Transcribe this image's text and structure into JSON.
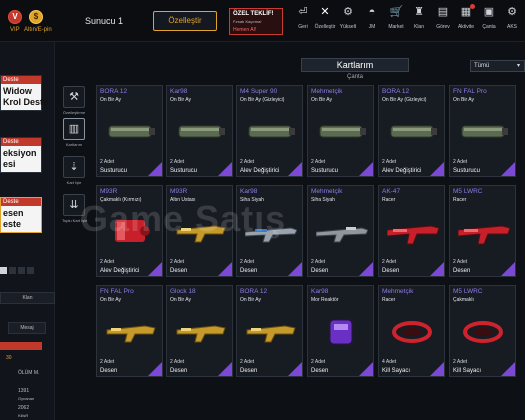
{
  "header": {
    "vip_label": "VIP",
    "currency_label": "Altın/E-pin",
    "server": "Sunucu 1",
    "customize": "Özelleştir",
    "offer": {
      "title": "ÖZEL TEKLİF!",
      "subtitle": "Fırsatı Kaçırma!",
      "timer": "Hemen Al!"
    }
  },
  "nav": [
    {
      "label": "Geri",
      "icon": "back-icon"
    },
    {
      "label": "Özelleştir",
      "icon": "tools-icon"
    },
    {
      "label": "Yükselt",
      "icon": "upgrade-icon"
    },
    {
      "label": "JM",
      "icon": "helmet-icon"
    },
    {
      "label": "Market",
      "icon": "cart-icon"
    },
    {
      "label": "Klan",
      "icon": "clan-icon"
    },
    {
      "label": "Görev",
      "icon": "mission-icon"
    },
    {
      "label": "Aktivite",
      "icon": "calendar-icon"
    },
    {
      "label": "Çanta",
      "icon": "bag-icon"
    },
    {
      "label": "AKS",
      "icon": "settings-icon"
    }
  ],
  "left_panel": {
    "decks": [
      {
        "head": "Deste",
        "body": "Widow\nKrol Deste"
      },
      {
        "head": "Deste",
        "body": "eksiyon\nesi"
      },
      {
        "head": "Deste",
        "body": "esen\neste"
      }
    ],
    "clan_label": "Klan",
    "message_label": "Mesaj",
    "level": "30",
    "death_label": "ÖLÜM M.",
    "stat1": "1391",
    "stat2": "2062",
    "stat1_label": "Oynanan",
    "stat2_label": "KillsR"
  },
  "toolbar": [
    {
      "label": "Özelleştirme",
      "icon": "customize-icon"
    },
    {
      "label": "Kartlarım",
      "icon": "cards-icon"
    },
    {
      "label": "Kart İşle",
      "icon": "card-process-icon"
    },
    {
      "label": "Toplu Kart İşle",
      "icon": "bulk-card-icon"
    }
  ],
  "main": {
    "title": "Kartlarım",
    "subtitle": "Çanta",
    "filter": "Tümü"
  },
  "cards": [
    {
      "name": "BORA 12",
      "duration": "On Bir Ay",
      "qty": "2 Adet",
      "type": "Susturucu",
      "art": "suppressor"
    },
    {
      "name": "Kar98",
      "duration": "On Bir Ay",
      "qty": "2 Adet",
      "type": "Susturucu",
      "art": "suppressor"
    },
    {
      "name": "M4 Super 90",
      "duration": "On Bir Ay (Gizleyici)",
      "qty": "2 Adet",
      "type": "Alev Değiştirici",
      "art": "suppressor"
    },
    {
      "name": "Mehmetçik",
      "duration": "On Bir Ay",
      "qty": "2 Adet",
      "type": "Susturucu",
      "art": "suppressor"
    },
    {
      "name": "BORA 12",
      "duration": "On Bir Ay (Gizleyici)",
      "qty": "2 Adet",
      "type": "Alev Değiştirici",
      "art": "suppressor"
    },
    {
      "name": "FN FAL Pro",
      "duration": "On Bir Ay",
      "qty": "2 Adet",
      "type": "Susturucu",
      "art": "suppressor"
    },
    {
      "name": "M93R",
      "duration": "Çakmaklı (Kırmızı)",
      "qty": "2 Adet",
      "type": "Alev Değiştirici",
      "art": "redcan"
    },
    {
      "name": "M93R",
      "duration": "Altın Ustası",
      "qty": "2 Adet",
      "type": "Desen",
      "art": "goldgun"
    },
    {
      "name": "Kar98",
      "duration": "Siha Siyah",
      "qty": "2 Adet",
      "type": "Desen",
      "art": "bluerifle"
    },
    {
      "name": "Mehmetçik",
      "duration": "Siha Siyah",
      "qty": "2 Adet",
      "type": "Desen",
      "art": "greyrifle"
    },
    {
      "name": "AK-47",
      "duration": "Racer",
      "qty": "2 Adet",
      "type": "Desen",
      "art": "redrifle"
    },
    {
      "name": "M5 LWRC",
      "duration": "Racer",
      "qty": "2 Adet",
      "type": "Desen",
      "art": "redrifle"
    },
    {
      "name": "FN FAL Pro",
      "duration": "On Bir Ay",
      "qty": "2 Adet",
      "type": "Desen",
      "art": "goldgun"
    },
    {
      "name": "Glock 18",
      "duration": "On Bir Ay",
      "qty": "2 Adet",
      "type": "Desen",
      "art": "goldgun"
    },
    {
      "name": "BORA 12",
      "duration": "On Bir Ay",
      "qty": "2 Adet",
      "type": "Desen",
      "art": "goldgun"
    },
    {
      "name": "Kar98",
      "duration": "Mor Reaktör",
      "qty": "2 Adet",
      "type": "Desen",
      "art": "purplemag"
    },
    {
      "name": "Mehmetçik",
      "duration": "Racer",
      "qty": "4 Adet",
      "type": "Kill Sayacı",
      "art": "redring"
    },
    {
      "name": "M5 LWRC",
      "duration": "Çakmaklı",
      "qty": "2 Adet",
      "type": "Kill Sayacı",
      "art": "redring"
    }
  ],
  "watermark": "Game Satış"
}
